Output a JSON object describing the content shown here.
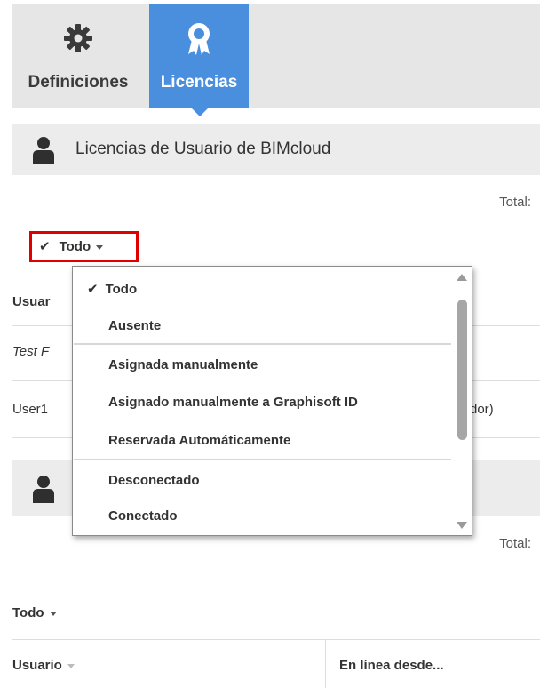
{
  "tabs": [
    {
      "label": "Definiciones",
      "icon": "gear-icon",
      "active": false
    },
    {
      "label": "Licencias",
      "icon": "award-ribbon-icon",
      "active": true
    }
  ],
  "section1": {
    "title": "Licencias de Usuario de BIMcloud",
    "icon": "user-icon",
    "total_label": "Total:",
    "filter": {
      "check": "✔",
      "label": "Todo"
    },
    "table": {
      "header_user": "Usuar",
      "rows": [
        {
          "col1": "Test F",
          "col2": ""
        },
        {
          "col1": "User1",
          "col2": "dor)"
        }
      ]
    }
  },
  "dropdown": {
    "check": "✔",
    "items": [
      {
        "label": "Todo",
        "checked": true
      },
      {
        "label": "Ausente",
        "checked": false
      },
      {
        "label": "Asignada manualmente",
        "checked": false
      },
      {
        "label": "Asignado manualmente a Graphisoft ID",
        "checked": false
      },
      {
        "label": "Reservada Automáticamente",
        "checked": false
      },
      {
        "label": "Desconectado",
        "checked": false
      },
      {
        "label": "Conectado",
        "checked": false
      }
    ]
  },
  "section2": {
    "icon": "user-icon",
    "total_label": "Total:",
    "filter": {
      "label": "Todo"
    },
    "table": {
      "header_user": "Usuario",
      "header_online": "En línea desde..."
    }
  },
  "colors": {
    "accent": "#4a8fdd",
    "highlight": "#e00000",
    "header_bg": "#e6e6e6"
  }
}
